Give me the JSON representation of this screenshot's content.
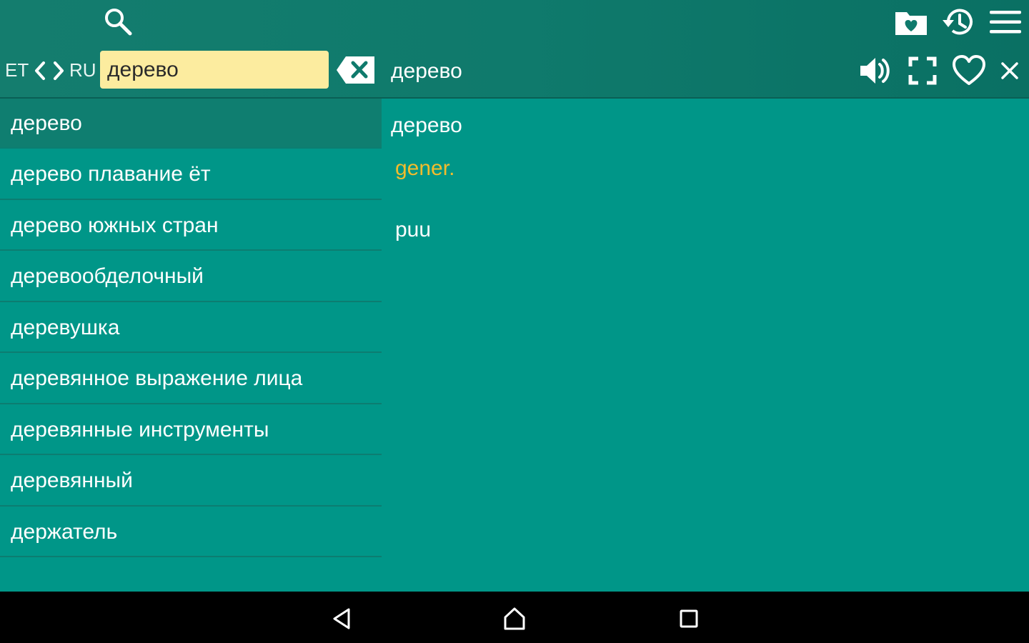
{
  "toolbar": {
    "search_icon": "search-icon",
    "favorites_folder_icon": "favorites-folder-icon",
    "history_icon": "history-icon",
    "menu_icon": "menu-icon"
  },
  "search_bar": {
    "lang_from": "ET",
    "lang_to": "RU",
    "query": "дерево"
  },
  "entry_header": {
    "word": "дерево"
  },
  "word_list": [
    "дерево",
    "дерево плавание ёт",
    "дерево южных стран",
    "деревообделочный",
    "деревушка",
    "деревянное выражение лица",
    "деревянные инструменты",
    "деревянный",
    "держатель"
  ],
  "detail": {
    "word": "дерево",
    "part_of_speech": "gener.",
    "translation": "puu"
  },
  "colors": {
    "background": "#009688",
    "topbar": "#0f7a6c",
    "search_field": "#fcec9f",
    "pos_label": "#f2bc2d",
    "navbar": "#000000"
  }
}
